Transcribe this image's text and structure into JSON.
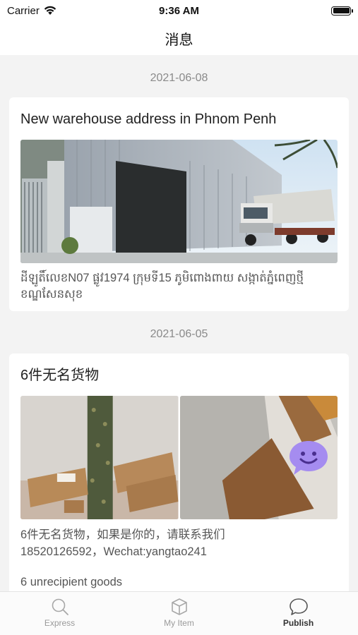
{
  "status": {
    "carrier": "Carrier",
    "time": "9:36 AM"
  },
  "nav": {
    "title": "消息"
  },
  "messages": [
    {
      "date": "2021-06-08",
      "title": "New warehouse address in Phnom Penh",
      "description": "ដីឡូតិ៍លេខN07 ផ្លូវ1974 ក្រុមទី15 ភូមិពោងពាយ សង្កាត់ភ្នំពេញថ្មី ខណ្ឌសែនសុខ"
    },
    {
      "date": "2021-06-05",
      "title": "6件无名货物",
      "description_line1": "6件无名货物，如果是你的，请联系我们",
      "description_line2": "18520126592，Wechat:yangtao241",
      "extra": "6 unrecipient goods"
    }
  ],
  "tabs": [
    {
      "label": "Express",
      "icon": "search-icon"
    },
    {
      "label": "My Item",
      "icon": "box-icon"
    },
    {
      "label": "Publish",
      "icon": "chat-icon"
    }
  ],
  "colors": {
    "accent_bubble": "#a58cf0",
    "background": "#f3f3f3"
  }
}
